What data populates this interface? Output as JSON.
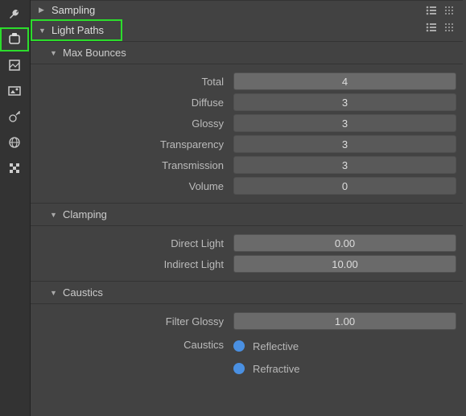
{
  "tabs": [
    {
      "name": "tools-icon"
    },
    {
      "name": "render-icon"
    },
    {
      "name": "output-icon"
    },
    {
      "name": "image-icon"
    },
    {
      "name": "scene-icon"
    },
    {
      "name": "world-icon"
    },
    {
      "name": "material-icon"
    }
  ],
  "sections": {
    "sampling": {
      "label": "Sampling"
    },
    "light_paths": {
      "label": "Light Paths"
    }
  },
  "max_bounces": {
    "title": "Max Bounces",
    "total": {
      "label": "Total",
      "value": "4"
    },
    "diffuse": {
      "label": "Diffuse",
      "value": "3"
    },
    "glossy": {
      "label": "Glossy",
      "value": "3"
    },
    "transparency": {
      "label": "Transparency",
      "value": "3"
    },
    "transmission": {
      "label": "Transmission",
      "value": "3"
    },
    "volume": {
      "label": "Volume",
      "value": "0"
    }
  },
  "clamping": {
    "title": "Clamping",
    "direct": {
      "label": "Direct Light",
      "value": "0.00"
    },
    "indirect": {
      "label": "Indirect Light",
      "value": "10.00"
    }
  },
  "caustics": {
    "title": "Caustics",
    "filter_glossy": {
      "label": "Filter Glossy",
      "value": "1.00"
    },
    "caustics_label": "Caustics",
    "reflective": "Reflective",
    "refractive": "Refractive"
  }
}
